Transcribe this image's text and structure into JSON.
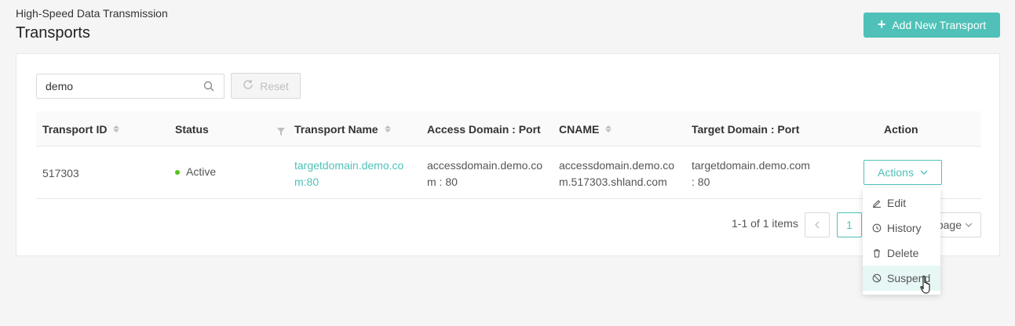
{
  "header": {
    "subtitle": "High-Speed Data Transmission",
    "title": "Transports",
    "add_button": "Add New Transport"
  },
  "filters": {
    "search_value": "demo",
    "reset_label": "Reset"
  },
  "table": {
    "columns": [
      "Transport ID",
      "Status",
      "Transport Name",
      "Access Domain : Port",
      "CNAME",
      "Target Domain : Port",
      "Action"
    ],
    "rows": [
      {
        "id": "517303",
        "status": "Active",
        "name": "targetdomain.demo.com:80",
        "access": "accessdomain.demo.com : 80",
        "cname": "accessdomain.demo.com.517303.shland.com",
        "target": "targetdomain.demo.com : 80",
        "action": "Actions"
      }
    ]
  },
  "pagination": {
    "total": "1-1 of 1 items",
    "page": "1",
    "page_size": "page"
  },
  "menu": {
    "items": [
      "Edit",
      "History",
      "Delete",
      "Suspend"
    ]
  },
  "colors": {
    "accent": "#4fc1b8",
    "active_dot": "#52c41a"
  }
}
